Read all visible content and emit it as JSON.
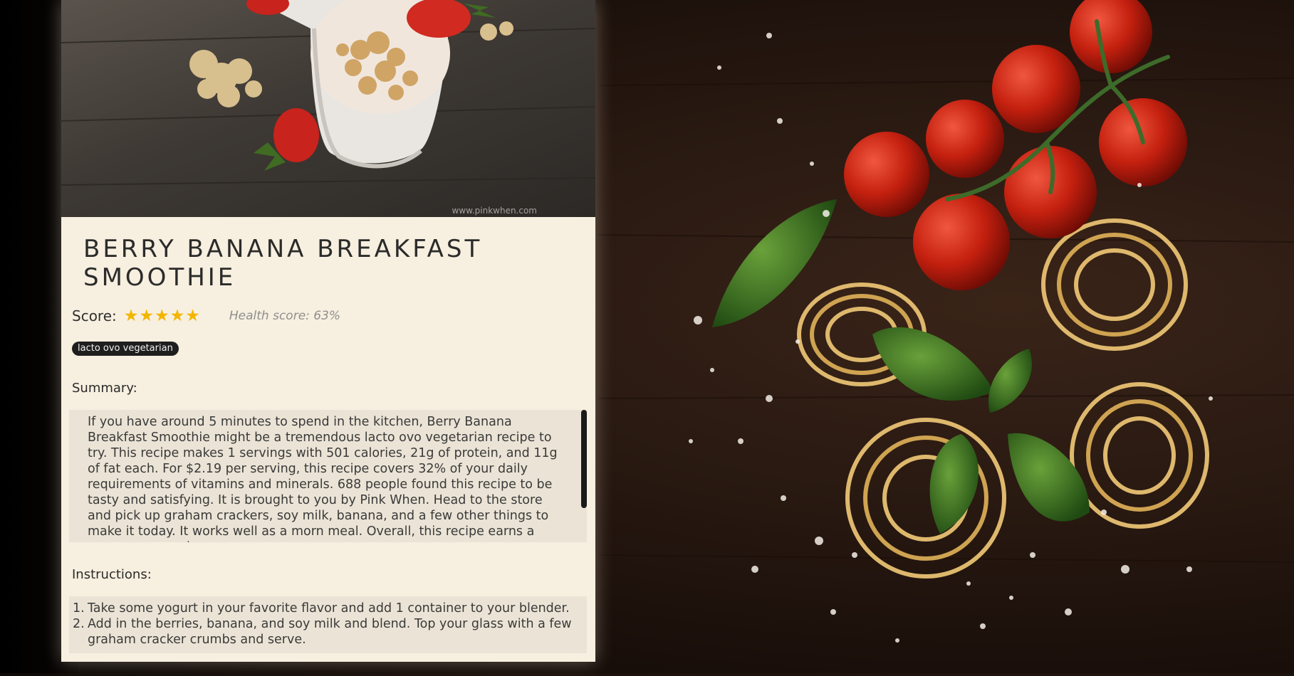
{
  "hero": {
    "watermark": "www.pinkwhen.com"
  },
  "recipe": {
    "title": "Berry Banana Breakfast Smoothie",
    "score_label": "Score:",
    "stars": "★★★★★",
    "star_count": 5,
    "health_score": "Health score: 63%",
    "diet_tag": "lacto ovo vegetarian"
  },
  "summary": {
    "label": "Summary:",
    "text": "If you have around 5 minutes to spend in the kitchen, Berry Banana Breakfast Smoothie might be a tremendous lacto ovo vegetarian recipe to try. This recipe makes 1 servings with 501 calories, 21g of protein, and 11g of fat each. For $2.19 per serving, this recipe covers 32% of your daily requirements of vitamins and minerals. 688 people found this recipe to be tasty and satisfying. It is brought to you by Pink When. Head to the store and pick up graham crackers, soy milk, banana, and a few other things to make it today. It works well as a morn meal. Overall, this recipe earns a super spoonacular"
  },
  "instructions": {
    "label": "Instructions:",
    "steps": [
      {
        "num": "1.",
        "text": "Take some yogurt in your favorite flavor and add 1 container to your blender."
      },
      {
        "num": "2.",
        "text": "Add in the berries, banana, and soy milk and blend. Top your glass with a few graham cracker crumbs and serve."
      }
    ]
  },
  "colors": {
    "card_bg": "#f7efdf",
    "box_bg": "#ebe4d6",
    "star": "#f2b600",
    "tag_bg": "#1e1e1e",
    "wood_bg": "#2a1a12"
  }
}
